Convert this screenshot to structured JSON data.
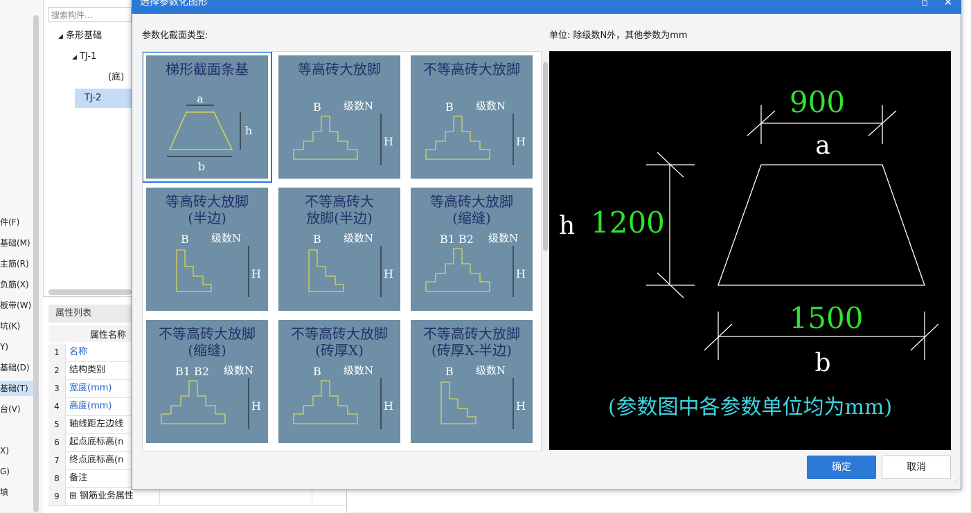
{
  "app": {
    "left_menu": [
      {
        "label": "件(F)"
      },
      {
        "label": "基础(M)"
      },
      {
        "label": "主筋(R)"
      },
      {
        "label": "负筋(X)"
      },
      {
        "label": "板带(W)"
      },
      {
        "label": "坑(K)"
      },
      {
        "label": "Y)"
      },
      {
        "label": "基础(D)"
      },
      {
        "label": "基础(T)",
        "selected": true
      },
      {
        "label": "台(V)"
      },
      {
        "label": "X)"
      },
      {
        "label": "G)"
      },
      {
        "label": "填"
      }
    ],
    "search_placeholder": "搜索构件...",
    "tree": {
      "root": "条形基础",
      "child1": "TJ-1",
      "child1_sub": "(底)",
      "child2": "TJ-2"
    },
    "properties": {
      "title": "属性列表",
      "header_name": "属性名称",
      "rows": [
        {
          "num": "1",
          "name": "名称",
          "link": true
        },
        {
          "num": "2",
          "name": "结构类别",
          "link": false
        },
        {
          "num": "3",
          "name": "宽度(mm)",
          "link": true
        },
        {
          "num": "4",
          "name": "高度(mm)",
          "link": true
        },
        {
          "num": "5",
          "name": "轴线距左边线",
          "link": false
        },
        {
          "num": "6",
          "name": "起点底标高(n",
          "link": false
        },
        {
          "num": "7",
          "name": "终点底标高(n",
          "link": false
        },
        {
          "num": "8",
          "name": "备注",
          "link": false
        },
        {
          "num": "9",
          "name": "⊞ 钢筋业务属性",
          "link": false
        }
      ]
    }
  },
  "dialog": {
    "title": "选择参数化图形",
    "section_label": "参数化截面类型:",
    "unit_label": "单位:  除级数N外，其他参数为mm",
    "ok_label": "确定",
    "cancel_label": "取消",
    "tiles": [
      {
        "label": "梯形截面条基",
        "selected": true
      },
      {
        "label": "等高砖大放脚",
        "selected": false
      },
      {
        "label": "不等高砖大放脚",
        "selected": false
      },
      {
        "label": "等高砖大放脚\n(半边)",
        "selected": false
      },
      {
        "label": "不等高砖大\n放脚(半边)",
        "selected": false
      },
      {
        "label": "等高砖大放脚\n(缩缝)",
        "selected": false
      },
      {
        "label": "不等高砖大放脚\n(缩缝)",
        "selected": false
      },
      {
        "label": "不等高砖大放脚\n(砖厚X)",
        "selected": false
      },
      {
        "label": "不等高砖大放脚\n(砖厚X-半边)",
        "selected": false
      }
    ],
    "tile_marks": {
      "a": "a",
      "b": "b",
      "h": "h",
      "H": "H",
      "B": "B",
      "N": "级数N",
      "B1": "B1",
      "B2": "B2"
    },
    "preview": {
      "a_value": "900",
      "a_label": "a",
      "h_value": "1200",
      "h_label": "h",
      "b_value": "1500",
      "b_label": "b",
      "note": "(参数图中各参数单位均为mm)"
    },
    "colors": {
      "accent": "#2b78d6",
      "tile_bg": "#6e8fa5",
      "value_green": "#2ee32e",
      "note_cyan": "#3fd3e0"
    }
  }
}
